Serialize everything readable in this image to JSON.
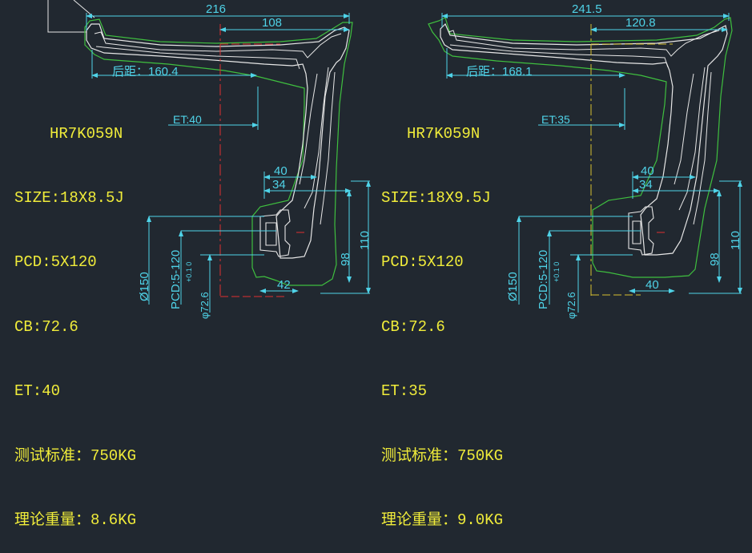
{
  "colors": {
    "background": "#212830",
    "profile_white": "#e6e6e6",
    "profile_green": "#3fbf3f",
    "dimension_cyan": "#4fd3e8",
    "text_yellow": "#f0ec3a",
    "centerline_red": "#e03030",
    "centerline_yellow": "#d8c030"
  },
  "left": {
    "model": "HR7K059N",
    "size": "SIZE:18X8.5J",
    "pcd": "PCD:5X120",
    "cb": "CB:72.6",
    "et": "ET:40",
    "test_standard": "测试标准：750KG",
    "weight": "理论重量：8.6KG",
    "dims": {
      "width": "216",
      "half_width": "108",
      "backspace": "后距：160.4",
      "et_label": "ET:40",
      "d40": "40",
      "d34": "34",
      "d42": "42",
      "d110": "110",
      "d98": "98",
      "d150": "Ø150",
      "pcd_v": "PCD:5-120",
      "cb_v": "φ72.6",
      "cb_tol": "+0.1  0"
    }
  },
  "right": {
    "model": "HR7K059N",
    "size": "SIZE:18X9.5J",
    "pcd": "PCD:5X120",
    "cb": "CB:72.6",
    "et": "ET:35",
    "test_standard": "测试标准：750KG",
    "weight": "理论重量：9.0KG",
    "dims": {
      "width": "241.5",
      "half_width": "120.8",
      "backspace": "后距：168.1",
      "et_label": "ET:35",
      "d40": "40",
      "d34": "34",
      "d40b": "40",
      "d110": "110",
      "d98": "98",
      "d150": "Ø150",
      "pcd_v": "PCD:5-120",
      "cb_v": "φ72.6",
      "cb_tol": "+0.1  0"
    }
  }
}
